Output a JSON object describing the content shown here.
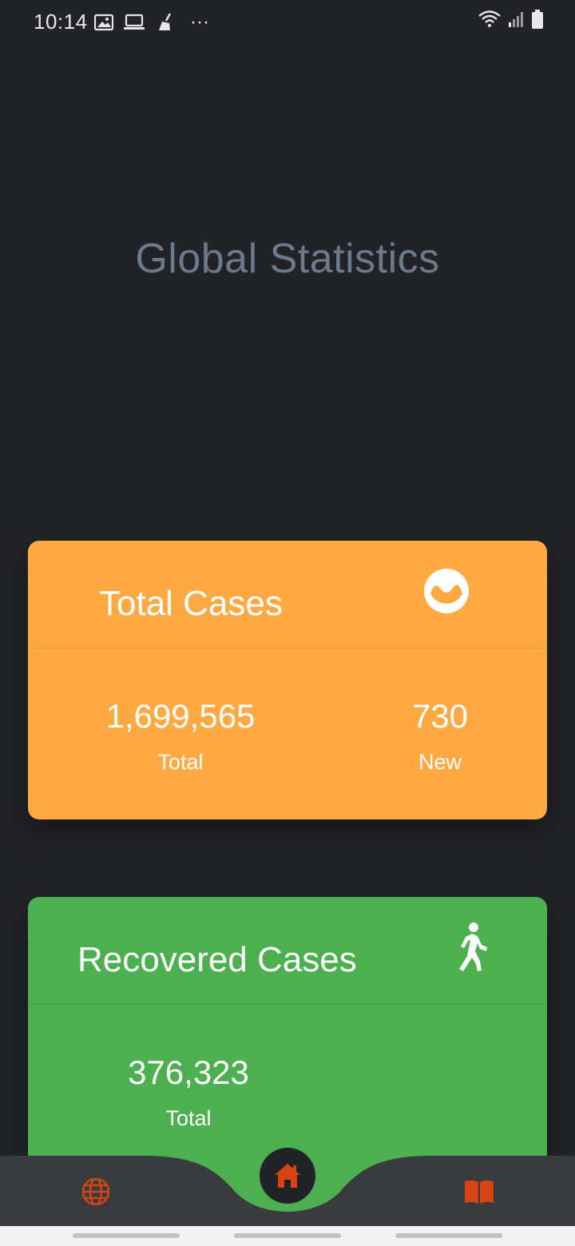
{
  "status_bar": {
    "time": "10:14",
    "overflow": "···"
  },
  "page": {
    "title": "Global Statistics"
  },
  "cards": {
    "total_cases": {
      "title": "Total Cases",
      "icon": "wave-circle-icon",
      "color": "#ffa942",
      "total_value": "1,699,565",
      "total_label": "Total",
      "new_value": "730",
      "new_label": "New"
    },
    "recovered_cases": {
      "title": "Recovered Cases",
      "icon": "walking-person-icon",
      "color": "#4caf50",
      "total_value": "376,323",
      "total_label": "Total"
    }
  },
  "bottom_nav": {
    "items": [
      {
        "name": "globe",
        "icon": "globe-icon"
      },
      {
        "name": "home",
        "icon": "home-icon",
        "selected": true
      },
      {
        "name": "book",
        "icon": "book-icon"
      }
    ],
    "accent": "#d84315"
  }
}
